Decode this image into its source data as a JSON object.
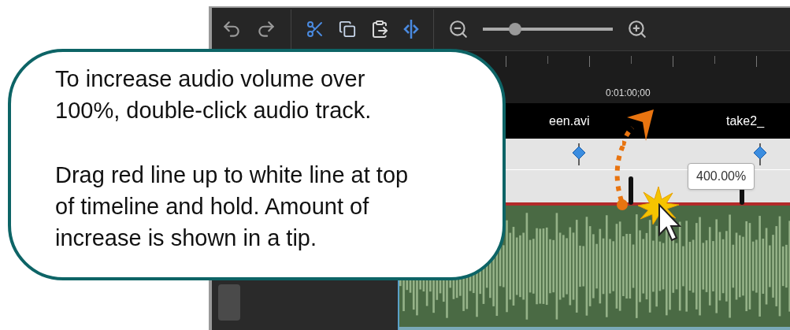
{
  "toolbar": {
    "zoom_slider": {
      "level": 0.25
    }
  },
  "ruler": {
    "time_label": "0:01:00;00"
  },
  "clips": [
    {
      "title": "een.avi"
    },
    {
      "title": "take2_"
    }
  ],
  "tooltip": "400.00%",
  "callout": {
    "paragraphs": [
      [
        "To increase audio volume over",
        "100%, double-click audio track."
      ],
      [
        "Drag red line up to white line at top",
        "of timeline and hold. Amount of",
        "increase is shown in a tip."
      ]
    ]
  }
}
